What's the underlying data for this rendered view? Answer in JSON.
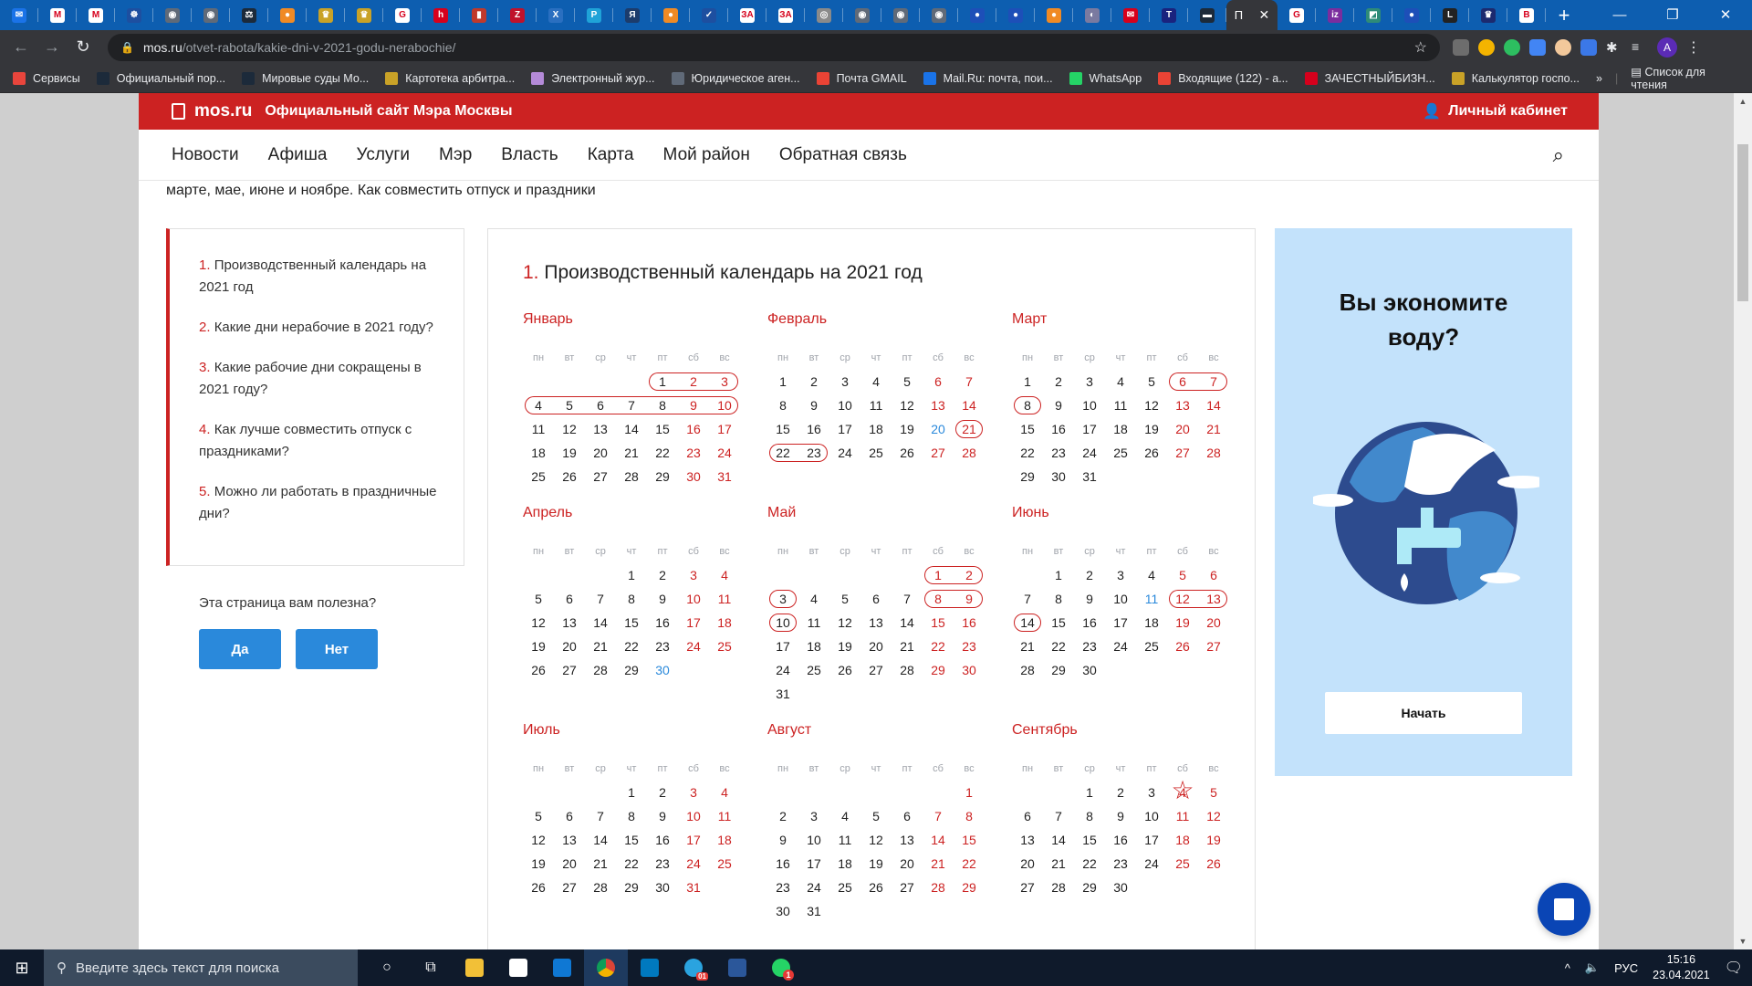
{
  "browser": {
    "tabs": [
      {
        "icon": "mail-icon",
        "color": "#1a73e8",
        "glyph": "✉"
      },
      {
        "icon": "gmail-icon",
        "color": "#ffffff",
        "glyph": "M"
      },
      {
        "icon": "gmail-icon",
        "color": "#ffffff",
        "glyph": "M"
      },
      {
        "icon": "emblem-icon",
        "color": "#1d4fa0",
        "glyph": "☸"
      },
      {
        "icon": "globe-icon",
        "color": "#606a78",
        "glyph": "◉"
      },
      {
        "icon": "globe-icon",
        "color": "#606a78",
        "glyph": "◉"
      },
      {
        "icon": "scales-icon",
        "color": "#1c2a3a",
        "glyph": "⚖"
      },
      {
        "icon": "orange-icon",
        "color": "#f08a24",
        "glyph": "●"
      },
      {
        "icon": "eagle-icon",
        "color": "#c9a227",
        "glyph": "♛"
      },
      {
        "icon": "eagle-icon",
        "color": "#c9a227",
        "glyph": "♛"
      },
      {
        "icon": "google-icon",
        "color": "#ffffff",
        "glyph": "G"
      },
      {
        "icon": "hh-icon",
        "color": "#d6001c",
        "glyph": "h"
      },
      {
        "icon": "book-icon",
        "color": "#c0392b",
        "glyph": "▮"
      },
      {
        "icon": "z-icon",
        "color": "#c0112b",
        "glyph": "Z"
      },
      {
        "icon": "x-icon",
        "color": "#2a6fc0",
        "glyph": "X"
      },
      {
        "icon": "p-icon",
        "color": "#1fa3d8",
        "glyph": "P"
      },
      {
        "icon": "news-icon",
        "color": "#1c3c6c",
        "glyph": "Я"
      },
      {
        "icon": "orange-icon",
        "color": "#f08a24",
        "glyph": "●"
      },
      {
        "icon": "check-icon",
        "color": "#1d4fa0",
        "glyph": "✓"
      },
      {
        "icon": "za-icon",
        "color": "#ffffff",
        "glyph": "ЗА"
      },
      {
        "icon": "za-icon",
        "color": "#ffffff",
        "glyph": "ЗА"
      },
      {
        "icon": "seal-icon",
        "color": "#8a8a8a",
        "glyph": "◎"
      },
      {
        "icon": "globe-icon",
        "color": "#606a78",
        "glyph": "◉"
      },
      {
        "icon": "globe-icon",
        "color": "#606a78",
        "glyph": "◉"
      },
      {
        "icon": "globe-icon",
        "color": "#606a78",
        "glyph": "◉"
      },
      {
        "icon": "sphere-icon",
        "color": "#1d4fb8",
        "glyph": "●"
      },
      {
        "icon": "sphere-icon",
        "color": "#1d4fb8",
        "glyph": "●"
      },
      {
        "icon": "orange-icon",
        "color": "#f08a24",
        "glyph": "●"
      },
      {
        "icon": "portrait-icon",
        "color": "#7a7aa0",
        "glyph": "◐"
      },
      {
        "icon": "mail-red-icon",
        "color": "#d6001c",
        "glyph": "✉"
      },
      {
        "icon": "t-icon",
        "color": "#1a237e",
        "glyph": "T"
      },
      {
        "icon": "building-icon",
        "color": "#1c2a3a",
        "glyph": "▬"
      }
    ],
    "active_tab": {
      "title": "П",
      "close": "✕"
    },
    "tabs_after": [
      {
        "icon": "google-icon",
        "color": "#ffffff",
        "glyph": "G"
      },
      {
        "icon": "iz-icon",
        "color": "#7b2d9e",
        "glyph": "iz"
      },
      {
        "icon": "diagonal-icon",
        "color": "#2e8b78",
        "glyph": "◩"
      },
      {
        "icon": "sphere-icon",
        "color": "#1d4fb8",
        "glyph": "●"
      },
      {
        "icon": "l-icon",
        "color": "#222222",
        "glyph": "L"
      },
      {
        "icon": "eagle-icon",
        "color": "#1c2a6e",
        "glyph": "♛"
      },
      {
        "icon": "b-icon",
        "color": "#ffffff",
        "glyph": "B"
      }
    ],
    "new_tab": "+",
    "window_controls": {
      "minimize": "—",
      "restore": "❐",
      "close": "✕"
    },
    "url_host": "mos.ru",
    "url_path": "/otvet-rabota/kakie-dni-v-2021-godu-nerabochie/",
    "profile_initial": "A",
    "bookmarks": [
      {
        "label": "Сервисы",
        "color": "#e8453c"
      },
      {
        "label": "Официальный пор...",
        "color": "#1c2a3a"
      },
      {
        "label": "Мировые суды Мо...",
        "color": "#1c2a3a"
      },
      {
        "label": "Картотека арбитра...",
        "color": "#c9a227"
      },
      {
        "label": "Электронный жур...",
        "color": "#b48ad8"
      },
      {
        "label": "Юридическое аген...",
        "color": "#606a78"
      },
      {
        "label": "Почта GMAIL",
        "color": "#ea4335"
      },
      {
        "label": "Mail.Ru: почта, пои...",
        "color": "#1a73e8"
      },
      {
        "label": "WhatsApp",
        "color": "#25d366"
      },
      {
        "label": "Входящие (122) - а...",
        "color": "#ea4335"
      },
      {
        "label": "ЗАЧЕСТНЫЙБИЗН...",
        "color": "#d6001c"
      },
      {
        "label": "Калькулятор госпо...",
        "color": "#c9a227"
      }
    ],
    "bookmarks_more": "»",
    "reading_list": "Список для чтения"
  },
  "site": {
    "logo": "mos.ru",
    "logo_subtitle": "Официальный сайт Мэра Москвы",
    "cabinet": "Личный кабинет",
    "nav": [
      "Новости",
      "Афиша",
      "Услуги",
      "Мэр",
      "Власть",
      "Карта",
      "Мой район",
      "Обратная связь"
    ],
    "lead_text": "марте, мае, июне и ноябре. Как совместить отпуск и праздники",
    "toc": [
      {
        "num": "1.",
        "text": "Производственный календарь на 2021 год"
      },
      {
        "num": "2.",
        "text": "Какие дни нерабочие в 2021 году?"
      },
      {
        "num": "3.",
        "text": "Какие рабочие дни сокращены в 2021 году?"
      },
      {
        "num": "4.",
        "text": "Как лучше совместить отпуск с праздниками?"
      },
      {
        "num": "5.",
        "text": "Можно ли работать в праздничные дни?"
      }
    ],
    "feedback": {
      "question": "Эта страница вам полезна?",
      "yes": "Да",
      "no": "Нет"
    },
    "calendar": {
      "heading_num": "1.",
      "heading": "Производственный календарь на 2021 год",
      "weekdays": [
        "пн",
        "вт",
        "ср",
        "чт",
        "пт",
        "сб",
        "вс"
      ],
      "months": [
        {
          "name": "Январь",
          "offset": 4,
          "days": 31,
          "weekend": [
            2,
            3,
            9,
            10,
            16,
            17,
            23,
            24,
            30,
            31
          ],
          "short": [],
          "holidays": [
            [
              1,
              3
            ],
            [
              4,
              10
            ]
          ],
          "star": []
        },
        {
          "name": "Февраль",
          "offset": 0,
          "days": 28,
          "weekend": [
            6,
            7,
            13,
            14,
            21,
            27,
            28
          ],
          "short": [
            20
          ],
          "holidays": [
            [
              21,
              21
            ],
            [
              22,
              23
            ]
          ],
          "star": []
        },
        {
          "name": "Март",
          "offset": 0,
          "days": 31,
          "weekend": [
            6,
            7,
            13,
            14,
            20,
            21,
            27,
            28
          ],
          "short": [],
          "holidays": [
            [
              6,
              7
            ],
            [
              8,
              8
            ]
          ],
          "star": []
        },
        {
          "name": "Апрель",
          "offset": 3,
          "days": 30,
          "weekend": [
            3,
            4,
            10,
            11,
            17,
            18,
            24,
            25
          ],
          "short": [
            30
          ],
          "holidays": [],
          "star": []
        },
        {
          "name": "Май",
          "offset": 5,
          "days": 31,
          "weekend": [
            1,
            2,
            8,
            9,
            15,
            16,
            22,
            23,
            29,
            30
          ],
          "short": [],
          "holidays": [
            [
              1,
              2
            ],
            [
              3,
              3
            ],
            [
              8,
              9
            ],
            [
              10,
              10
            ]
          ],
          "star": []
        },
        {
          "name": "Июнь",
          "offset": 1,
          "days": 30,
          "weekend": [
            5,
            6,
            12,
            13,
            19,
            20,
            26,
            27
          ],
          "short": [
            11
          ],
          "holidays": [
            [
              12,
              13
            ],
            [
              14,
              14
            ]
          ],
          "star": []
        },
        {
          "name": "Июль",
          "offset": 3,
          "days": 31,
          "weekend": [
            3,
            4,
            10,
            11,
            17,
            18,
            24,
            25,
            31
          ],
          "short": [],
          "holidays": [],
          "star": []
        },
        {
          "name": "Август",
          "offset": 6,
          "days": 31,
          "weekend": [
            1,
            7,
            8,
            14,
            15,
            21,
            22,
            28,
            29
          ],
          "short": [],
          "holidays": [],
          "star": []
        },
        {
          "name": "Сентябрь",
          "offset": 2,
          "days": 30,
          "weekend": [
            4,
            5,
            11,
            12,
            18,
            19,
            25,
            26
          ],
          "short": [],
          "holidays": [],
          "star": [
            4
          ]
        }
      ]
    },
    "ad": {
      "title": "Вы экономите воду?",
      "button": "Начать"
    }
  },
  "taskbar": {
    "search_placeholder": "Введите здесь текст для поиска",
    "language": "РУС",
    "time": "15:16",
    "date": "23.04.2021",
    "telegram_badge": "01",
    "whatsapp_badge": "1"
  }
}
